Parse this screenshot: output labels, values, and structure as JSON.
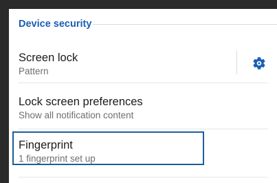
{
  "section": {
    "title": "Device security"
  },
  "items": [
    {
      "title": "Screen lock",
      "subtitle": "Pattern",
      "action_icon": "gear-icon"
    },
    {
      "title": "Lock screen preferences",
      "subtitle": "Show all notification content"
    },
    {
      "title": "Fingerprint",
      "subtitle": "1 fingerprint set up",
      "focused": true
    }
  ],
  "colors": {
    "background": "#2a2a2a",
    "accent": "#1a5fb4",
    "focus_outline": "#1c5d99",
    "divider": "#e3e6e9"
  }
}
